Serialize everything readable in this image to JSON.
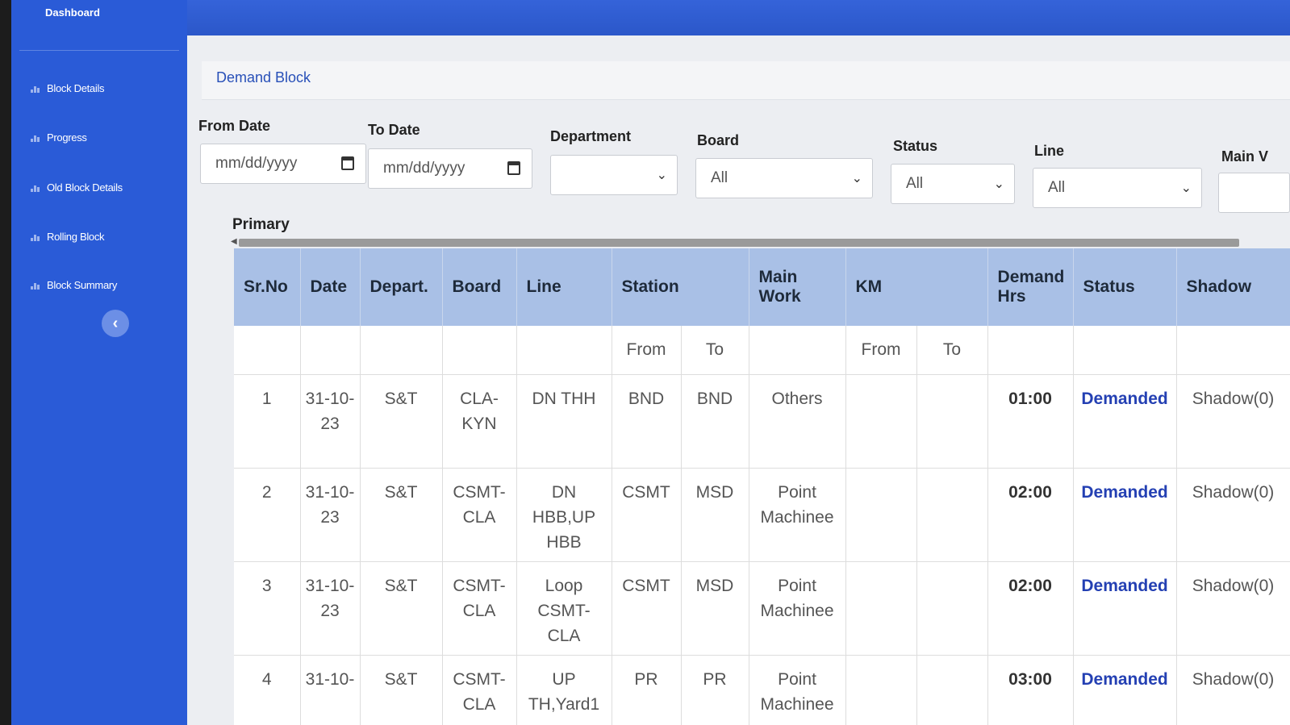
{
  "sidebar": {
    "brand": "Dashboard",
    "items": [
      {
        "label": "Block Details"
      },
      {
        "label": "Progress"
      },
      {
        "label": "Old Block Details"
      },
      {
        "label": "Rolling Block"
      },
      {
        "label": "Block Summary"
      }
    ],
    "collapse_glyph": "‹"
  },
  "page": {
    "title": "Demand Block"
  },
  "filters": {
    "from_date": {
      "label": "From Date",
      "placeholder": "mm/dd/yyyy"
    },
    "to_date": {
      "label": "To Date",
      "placeholder": "mm/dd/yyyy"
    },
    "department": {
      "label": "Department",
      "value": ""
    },
    "board": {
      "label": "Board",
      "value": "All"
    },
    "status": {
      "label": "Status",
      "value": "All"
    },
    "line": {
      "label": "Line",
      "value": "All"
    },
    "main_work": {
      "label": "Main V"
    }
  },
  "section": {
    "label": "Primary"
  },
  "table": {
    "headers": [
      "Sr.No",
      "Date",
      "Depart.",
      "Board",
      "Line",
      "Station",
      "Main Work",
      "KM",
      "Demand Hrs",
      "Status",
      "Shadow"
    ],
    "subheaders": {
      "station_from": "From",
      "station_to": "To",
      "km_from": "From",
      "km_to": "To"
    },
    "rows": [
      {
        "sr": "1",
        "date": "31-10-23",
        "depart": "S&T",
        "board": "CLA-KYN",
        "line": "DN THH",
        "from": "BND",
        "to": "BND",
        "work": "Others",
        "km_from": "",
        "km_to": "",
        "hrs": "01:00",
        "status": "Demanded",
        "shadow": "Shadow(0)"
      },
      {
        "sr": "2",
        "date": "31-10-23",
        "depart": "S&T",
        "board": "CSMT-CLA",
        "line": "DN HBB,UP HBB",
        "from": "CSMT",
        "to": "MSD",
        "work": "Point Machinee",
        "km_from": "",
        "km_to": "",
        "hrs": "02:00",
        "status": "Demanded",
        "shadow": "Shadow(0)"
      },
      {
        "sr": "3",
        "date": "31-10-23",
        "depart": "S&T",
        "board": "CSMT-CLA",
        "line": "Loop CSMT-CLA",
        "from": "CSMT",
        "to": "MSD",
        "work": "Point Machinee",
        "km_from": "",
        "km_to": "",
        "hrs": "02:00",
        "status": "Demanded",
        "shadow": "Shadow(0)"
      },
      {
        "sr": "4",
        "date": "31-10-",
        "depart": "S&T",
        "board": "CSMT-CLA",
        "line": "UP TH,Yard1",
        "from": "PR",
        "to": "PR",
        "work": "Point Machinee",
        "km_from": "",
        "km_to": "",
        "hrs": "03:00",
        "status": "Demanded",
        "shadow": "Shadow(0)"
      }
    ]
  },
  "colors": {
    "sidebar": "#2a5bd7",
    "header": "#a9c0e6",
    "link": "#2440b3",
    "title": "#2850b8"
  },
  "icons": {
    "sidebar_item": "bar-chart-icon",
    "date_field": "calendar-icon",
    "select": "chevron-down-icon",
    "collapse": "chevron-left-icon"
  }
}
